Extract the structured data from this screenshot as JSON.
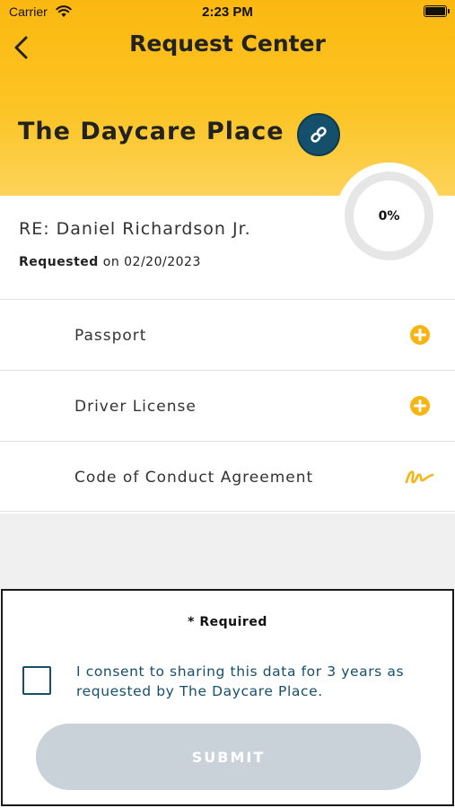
{
  "status_bar": {
    "carrier": "Carrier",
    "time": "2:23 PM"
  },
  "nav": {
    "title": "Request Center"
  },
  "request": {
    "organization": "The Daycare Place",
    "progress_label": "0%",
    "progress_value": 0,
    "re_line": "RE: Daniel Richardson Jr.",
    "requested_label": "Requested",
    "requested_on": "on 02/20/2023"
  },
  "items": [
    {
      "label": "Passport",
      "icon": "add-circle-icon"
    },
    {
      "label": "Driver License",
      "icon": "add-circle-icon"
    },
    {
      "label": "Code of Conduct Agreement",
      "icon": "signature-icon"
    }
  ],
  "consent": {
    "required_label": "* Required",
    "consent_text": "I consent to sharing this data for 3 years as requested by The Daycare Place.",
    "checked": false,
    "submit_label": "SUBMIT"
  },
  "colors": {
    "header_yellow": "#fcc423",
    "accent_yellow": "#f6b512",
    "dark_teal": "#14506b",
    "disabled_button": "#c9d2d9"
  }
}
